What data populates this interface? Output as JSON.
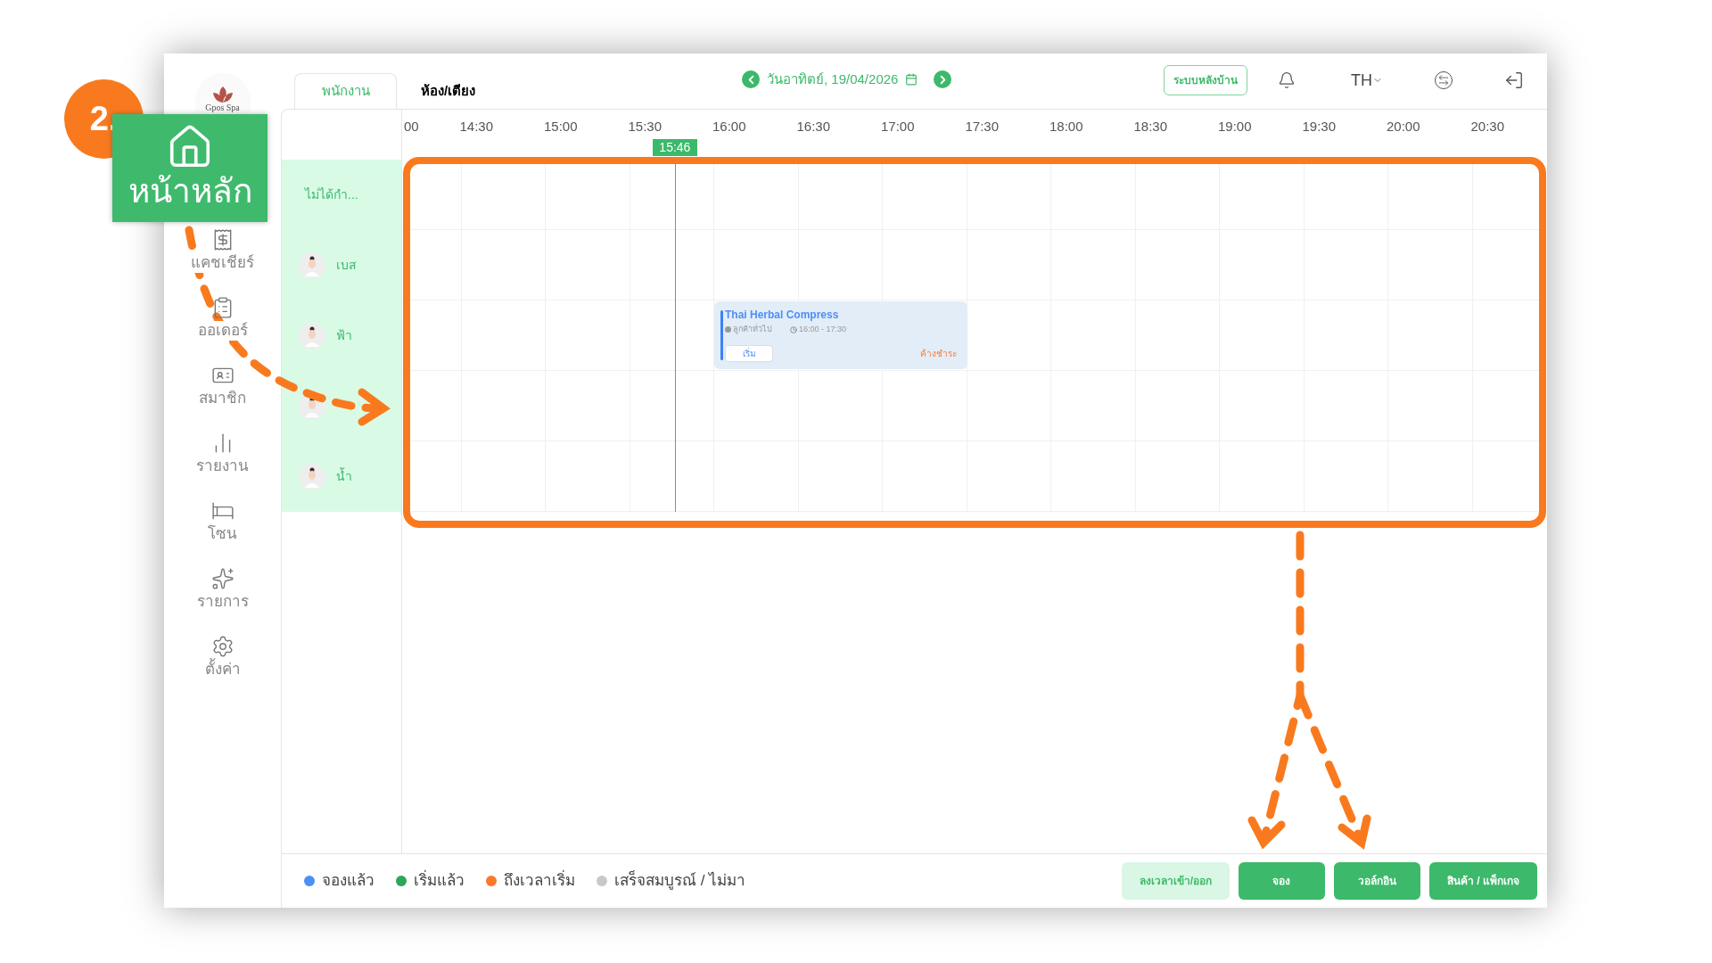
{
  "annotations": {
    "step": "2.",
    "callout": "หน้าหลัก"
  },
  "sidebar": {
    "logo": "Gpos Spa",
    "items": [
      {
        "label": "แคชเชียร์",
        "kind": "cashier"
      },
      {
        "label": "ออเดอร์",
        "kind": "orders"
      },
      {
        "label": "สมาชิก",
        "kind": "members"
      },
      {
        "label": "รายงาน",
        "kind": "reports"
      },
      {
        "label": "โซน",
        "kind": "zones"
      },
      {
        "label": "รายการ",
        "kind": "services"
      },
      {
        "label": "ตั้งค่า",
        "kind": "settings"
      }
    ]
  },
  "tabs": [
    {
      "label": "พนักงาน",
      "selected": true
    },
    {
      "label": "ห้อง/เตียง",
      "selected": false
    }
  ],
  "date": "วันอาทิตย์, 19/04/2026",
  "header": {
    "backoffice_button": "ระบบหลังบ้าน",
    "language": "TH"
  },
  "time_ticks": [
    "00",
    "14:30",
    "15:00",
    "15:30",
    "16:00",
    "16:30",
    "17:00",
    "17:30",
    "18:00",
    "18:30",
    "19:00",
    "19:30",
    "20:00",
    "20:30"
  ],
  "current_time": "15:46",
  "staff": [
    {
      "kind": "unassigned",
      "name": "ไม่ได้กำ..."
    },
    {
      "kind": "staff",
      "name": "เบส"
    },
    {
      "kind": "staff",
      "name": "ฟ้า",
      "bookings": [
        {
          "service": "Thai Herbal Compress",
          "customer": "ลูกค้าทั่วไป",
          "time": "16:00 - 17:30",
          "action": "เริ่ม",
          "payment": "ค้างชำระ",
          "color": "#3b82f6"
        }
      ]
    },
    {
      "kind": "staff"
    },
    {
      "kind": "staff",
      "name": "น้ำ"
    }
  ],
  "legend": [
    {
      "label": "จองแล้ว",
      "color": "#4f8ef7"
    },
    {
      "label": "เริ่มแล้ว",
      "color": "#2fa55a"
    },
    {
      "label": "ถึงเวลาเริ่ม",
      "color": "#f97a2e"
    },
    {
      "label": "เสร็จสมบูรณ์ / ไม่มา",
      "color": "#c8c8c8"
    }
  ],
  "buttons": [
    {
      "label": "ลงเวลาเข้า/ออก",
      "kind": "light"
    },
    {
      "label": "จอง",
      "kind": "primary"
    },
    {
      "label": "วอล์กอิน",
      "kind": "primary"
    },
    {
      "label": "สินค้า / แพ็กเกจ",
      "kind": "primary"
    }
  ]
}
